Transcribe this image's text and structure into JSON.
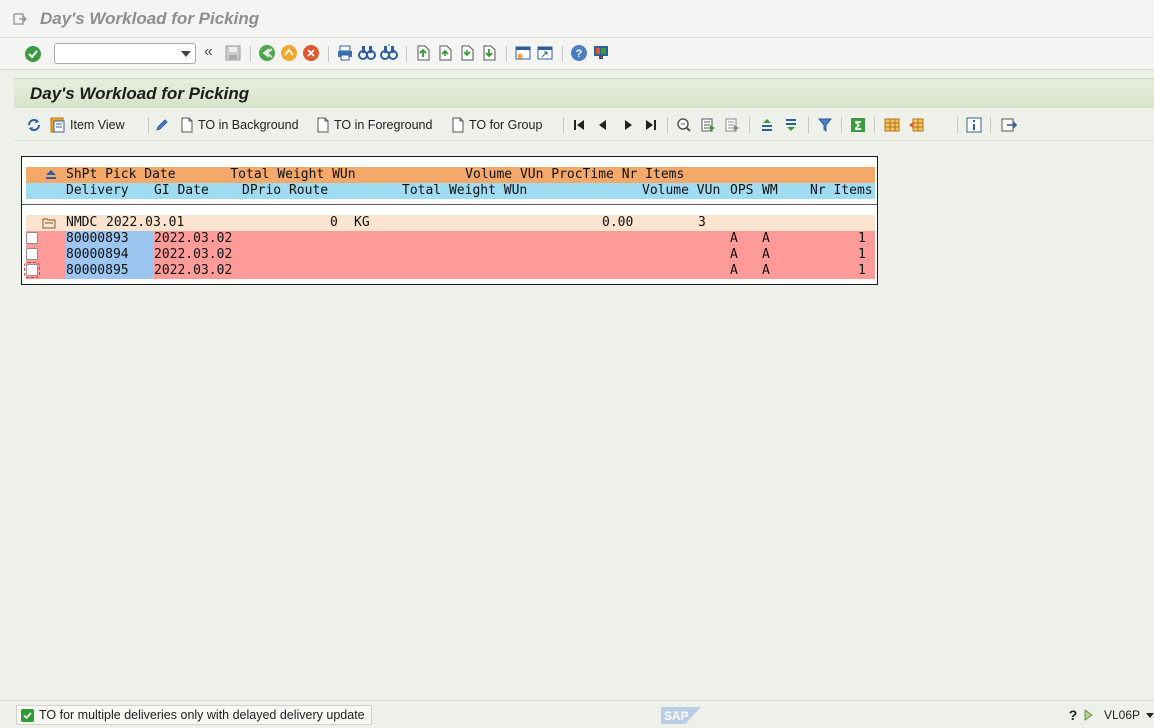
{
  "window": {
    "title": "Day's Workload for Picking"
  },
  "system_toolbar": {
    "command_field": "",
    "double_arrow": "«"
  },
  "screen": {
    "title": "Day's Workload for Picking"
  },
  "app_toolbar": {
    "item_view": "Item View",
    "to_background": "TO in Background",
    "to_foreground": "TO in Foreground",
    "to_group": "TO for Group"
  },
  "list": {
    "header1": "ShPt Pick Date       Total Weight WUn              Volume VUn ProcTime Nr Items",
    "header2": {
      "delivery": "Delivery",
      "gi_date": "GI Date",
      "dprio_route": "DPrio Route",
      "total_weight_wun": "Total Weight WUn",
      "volume_vun": "Volume VUn",
      "ops": "OPS",
      "wm": "WM",
      "nr_items": "Nr Items"
    },
    "group": {
      "shpt": "NMDC",
      "pick_date": "2022.03.01",
      "total_weight": "0",
      "wun": "KG",
      "volume": "0.00",
      "proc_time": "3"
    },
    "rows": [
      {
        "delivery": "80000893",
        "gi_date": "2022.03.02",
        "ops": "A",
        "wm": "A",
        "nr_items": "1"
      },
      {
        "delivery": "80000894",
        "gi_date": "2022.03.02",
        "ops": "A",
        "wm": "A",
        "nr_items": "1"
      },
      {
        "delivery": "80000895",
        "gi_date": "2022.03.02",
        "ops": "A",
        "wm": "A",
        "nr_items": "1"
      }
    ]
  },
  "status": {
    "message": "TO for multiple deliveries only with delayed delivery update",
    "transaction": "VL06P",
    "logo": "SAP"
  },
  "colors": {
    "header_orange": "#f4a86a",
    "header_blue": "#9fdcf2",
    "row_red": "#ff9c9a",
    "group_row": "#fbe4cf"
  }
}
